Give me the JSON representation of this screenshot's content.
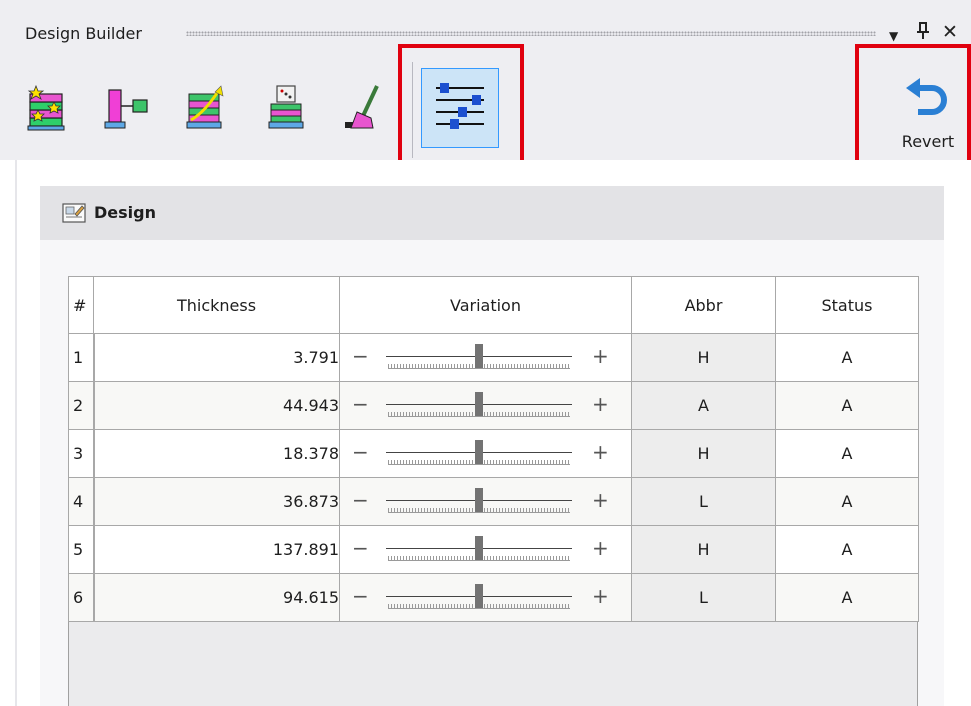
{
  "window": {
    "title": "Design Builder",
    "dropdown_glyph": "▼",
    "pin_glyph": "⊥",
    "close_glyph": "✕"
  },
  "ribbon": {
    "buttons": [
      {
        "icon": "magic-stack-icon",
        "active": false
      },
      {
        "icon": "layer-probe-icon",
        "active": false
      },
      {
        "icon": "layer-growth-icon",
        "active": false
      },
      {
        "icon": "random-dice-stack-icon",
        "active": false
      },
      {
        "icon": "broom-clean-icon",
        "active": false
      },
      {
        "icon": "slider-adjust-icon",
        "active": true
      }
    ],
    "revert_label": "Revert",
    "highlight_color": "#e0000f"
  },
  "panel": {
    "title": "Design",
    "icon": "design-panel-icon"
  },
  "grid": {
    "columns": [
      "#",
      "Thickness",
      "Variation",
      "Abbr",
      "Status"
    ],
    "minus_glyph": "−",
    "plus_glyph": "+",
    "rows": [
      {
        "num": "1",
        "thickness": "3.791",
        "variation": 0.5,
        "abbr": "H",
        "status": "A"
      },
      {
        "num": "2",
        "thickness": "44.943",
        "variation": 0.5,
        "abbr": "A",
        "status": "A"
      },
      {
        "num": "3",
        "thickness": "18.378",
        "variation": 0.5,
        "abbr": "H",
        "status": "A"
      },
      {
        "num": "4",
        "thickness": "36.873",
        "variation": 0.5,
        "abbr": "L",
        "status": "A"
      },
      {
        "num": "5",
        "thickness": "137.891",
        "variation": 0.5,
        "abbr": "H",
        "status": "A"
      },
      {
        "num": "6",
        "thickness": "94.615",
        "variation": 0.5,
        "abbr": "L",
        "status": "A"
      }
    ]
  }
}
